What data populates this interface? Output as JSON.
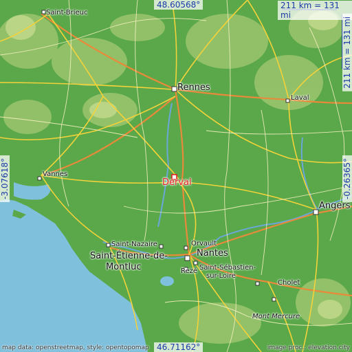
{
  "coords": {
    "top": "48.60568°",
    "bottom": "46.71162°",
    "left": "-3.07618°",
    "right": "-0.26365°"
  },
  "scale": {
    "horizontal": "211 km = 131 mi",
    "vertical": "211 km = 131 mi"
  },
  "cities": {
    "highlight": "Derval",
    "saint_brieuc": "Saint-Brieuc",
    "rennes": "Rennes",
    "laval": "Laval",
    "vannes": "Vannes",
    "angers": "Angers",
    "saint_nazaire": "Saint-Nazaire",
    "saint_etienne_1": "Saint-Étienne-de-",
    "saint_etienne_2": "Montluc",
    "orvault": "Orvault",
    "nantes": "Nantes",
    "saint_sebastien_1": "Saint-Sébastien-",
    "saint_sebastien_2": "sur-Loire",
    "reze": "Rezé",
    "cholet": "Cholet",
    "mont_mercure": "Mont Mercure"
  },
  "credits": {
    "left": "map data: openstreetmap, style: opentopomap",
    "right": "image proc.: elevation.city"
  },
  "colors": {
    "sea": "#7fc0dc",
    "land": "#5aa84a",
    "highland": "#a9c97a",
    "road": "#f4d23a",
    "motorway": "#e98a3a",
    "river": "#6aa7d8",
    "coord_text": "#1a3aa8",
    "marker": "#e02020"
  }
}
